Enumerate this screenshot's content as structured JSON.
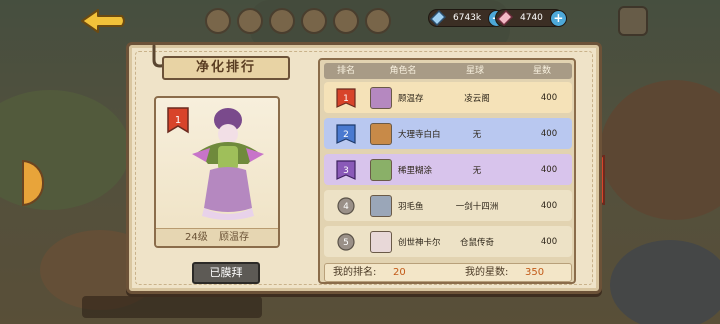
{
  "hud": {
    "resource_1": "6743k",
    "resource_2": "4740"
  },
  "panel": {
    "title": "净化排行",
    "portrait": {
      "rank": "1",
      "level": "24级",
      "name": "顾温存"
    },
    "worship_button": "已膜拜",
    "table": {
      "headers": [
        "排名",
        "角色名",
        "星球",
        "星数"
      ],
      "rows": [
        {
          "rank": "1",
          "name": "顾温存",
          "planet": "凌云阁",
          "stars": "400"
        },
        {
          "rank": "2",
          "name": "大理寺白白",
          "planet": "无",
          "stars": "400"
        },
        {
          "rank": "3",
          "name": "稀里糊涂",
          "planet": "无",
          "stars": "400"
        },
        {
          "rank": "4",
          "name": "羽毛鱼",
          "planet": "一剑十四洲",
          "stars": "400"
        },
        {
          "rank": "5",
          "name": "创世神卡尔",
          "planet": "仓鼠传奇",
          "stars": "400"
        }
      ]
    },
    "my_rank_label": "我的排名:",
    "my_rank_value": "20",
    "my_stars_label": "我的星数:",
    "my_stars_value": "350"
  },
  "colors": {
    "row_1": "#f5e2b8",
    "row_2": "#b9c8f0",
    "row_3": "#d8c4ec",
    "row_4": "#ede2c6",
    "row_5": "#ede2c6",
    "accent": "#c25a18"
  }
}
